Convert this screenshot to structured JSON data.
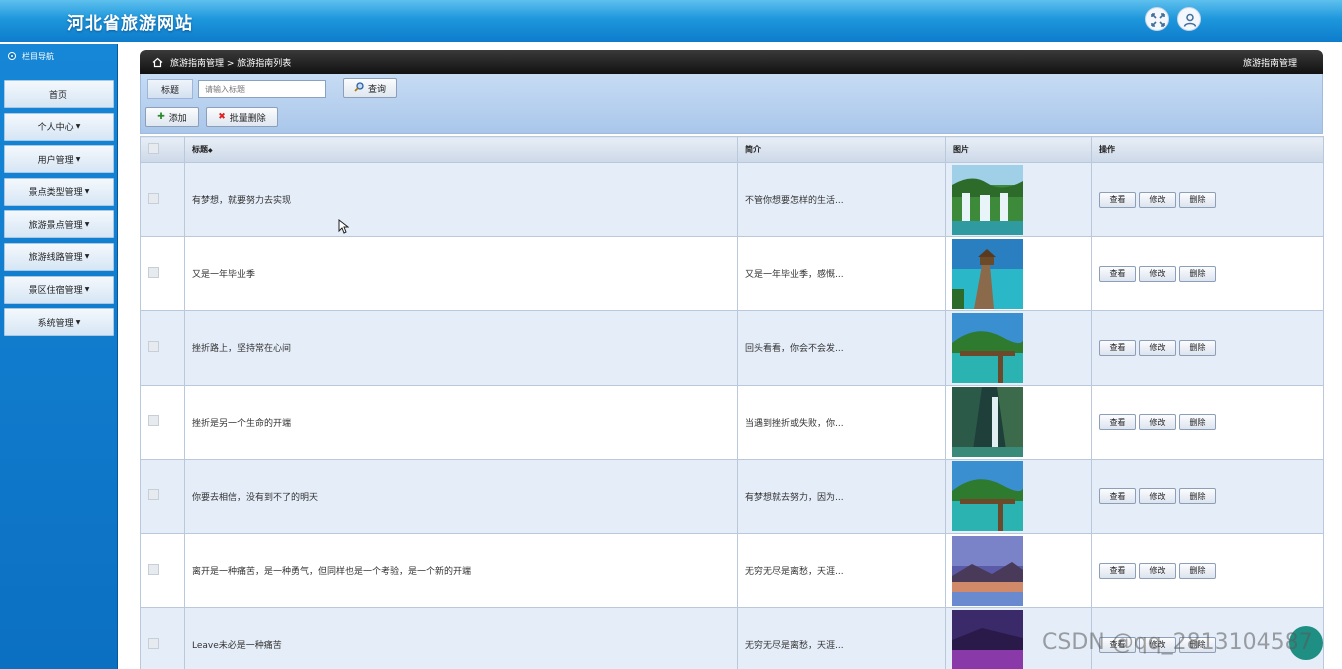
{
  "site": {
    "title": "河北省旅游网站"
  },
  "header_icons": [
    "fullscreen-icon",
    "user-icon"
  ],
  "sidebar": {
    "head": "栏目导航",
    "items": [
      {
        "label": "首页",
        "caret": ""
      },
      {
        "label": "个人中心",
        "caret": "▼"
      },
      {
        "label": "用户管理",
        "caret": "▼"
      },
      {
        "label": "景点类型管理",
        "caret": "▼"
      },
      {
        "label": "旅游景点管理",
        "caret": "▼"
      },
      {
        "label": "旅游线路管理",
        "caret": "▼"
      },
      {
        "label": "景区住宿管理",
        "caret": "▼"
      },
      {
        "label": "系统管理",
        "caret": "▼"
      }
    ]
  },
  "breadcrumb": {
    "path": "旅游指南管理 > 旅游指南列表",
    "right": "旅游指南管理"
  },
  "toolbar": {
    "search_label": "标题",
    "search_placeholder": "请输入标题",
    "search_button": "查询",
    "add_button": "添加",
    "batch_delete_button": "批量删除"
  },
  "table": {
    "headers": {
      "title": "标题",
      "sort_mark": "◆",
      "intro": "简介",
      "image": "图片",
      "ops": "操作"
    },
    "ops": {
      "view": "查看",
      "edit": "修改",
      "delete": "删除"
    },
    "rows": [
      {
        "title": "有梦想，就要努力去实现",
        "intro": "不管你想要怎样的生活..."
      },
      {
        "title": "又是一年毕业季",
        "intro": "又是一年毕业季，感慨..."
      },
      {
        "title": "挫折路上，坚持常在心间",
        "intro": "回头看看，你会不会发..."
      },
      {
        "title": "挫折是另一个生命的开端",
        "intro": "当遇到挫折或失败，你..."
      },
      {
        "title": "你要去相信，没有到不了的明天",
        "intro": "有梦想就去努力，因为..."
      },
      {
        "title": "离开是一种痛苦，是一种勇气，但同样也是一个考验，是一个新的开端",
        "intro": "无穷无尽是离愁，天涯..."
      },
      {
        "title": "Leave未必是一种痛苦",
        "intro": "无穷无尽是离愁，天涯..."
      }
    ]
  },
  "watermark": "CSDN @qq_2813104587",
  "colors": {
    "banner": "#1e97dc",
    "sidebar": "#0c78c8",
    "toolbar": "#b6cfee",
    "row_alt": "#e4edf8"
  }
}
